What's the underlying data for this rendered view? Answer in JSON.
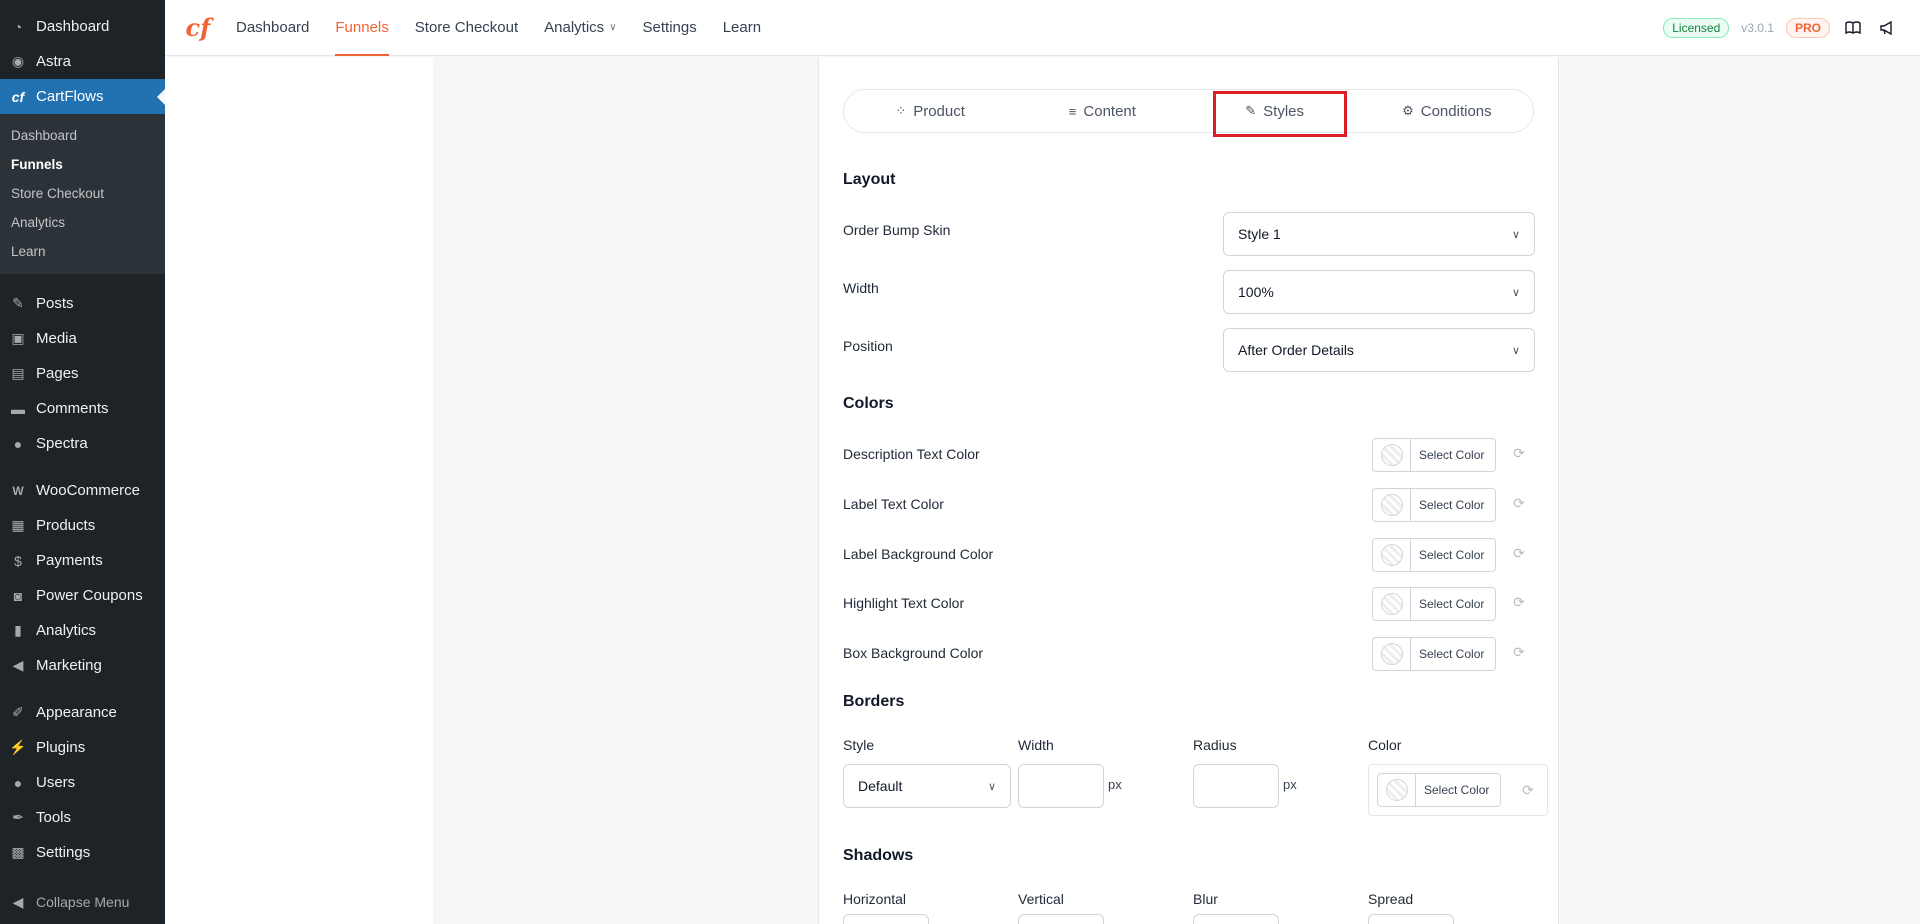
{
  "sidebar": {
    "items_top": [
      {
        "label": "Dashboard",
        "icon": "dashboard-icon"
      },
      {
        "label": "Astra",
        "icon": "astra-icon"
      },
      {
        "label": "CartFlows",
        "icon": "cartflows-icon"
      }
    ],
    "sub_items": [
      "Dashboard",
      "Funnels",
      "Store Checkout",
      "Analytics",
      "Learn"
    ],
    "items_group1": [
      {
        "label": "Posts",
        "icon": "pin-icon"
      },
      {
        "label": "Media",
        "icon": "media-icon"
      },
      {
        "label": "Pages",
        "icon": "pages-icon"
      },
      {
        "label": "Comments",
        "icon": "comment-icon"
      },
      {
        "label": "Spectra",
        "icon": "spectra-icon"
      }
    ],
    "items_group2": [
      {
        "label": "WooCommerce",
        "icon": "woo-icon"
      },
      {
        "label": "Products",
        "icon": "products-icon"
      },
      {
        "label": "Payments",
        "icon": "payments-icon"
      },
      {
        "label": "Power Coupons",
        "icon": "coupon-icon"
      },
      {
        "label": "Analytics",
        "icon": "bar-chart-icon"
      },
      {
        "label": "Marketing",
        "icon": "megaphone-icon"
      }
    ],
    "items_group3": [
      {
        "label": "Appearance",
        "icon": "brush-icon"
      },
      {
        "label": "Plugins",
        "icon": "plugin-icon"
      },
      {
        "label": "Users",
        "icon": "user-icon"
      },
      {
        "label": "Tools",
        "icon": "wrench-icon"
      },
      {
        "label": "Settings",
        "icon": "settings-icon"
      }
    ],
    "collapse_label": "Collapse Menu"
  },
  "topnav": {
    "items": [
      "Dashboard",
      "Funnels",
      "Store Checkout",
      "Analytics",
      "Settings",
      "Learn"
    ],
    "licensed": "Licensed",
    "version": "v3.0.1",
    "pro": "PRO"
  },
  "tabs": [
    "Product",
    "Content",
    "Styles",
    "Conditions"
  ],
  "layout": {
    "title": "Layout",
    "skin_label": "Order Bump Skin",
    "skin_value": "Style 1",
    "width_label": "Width",
    "width_value": "100%",
    "position_label": "Position",
    "position_value": "After Order Details"
  },
  "colors": {
    "title": "Colors",
    "select_text": "Select Color",
    "rows": [
      "Description Text Color",
      "Label Text Color",
      "Label Background Color",
      "Highlight Text Color",
      "Box Background Color"
    ]
  },
  "borders": {
    "title": "Borders",
    "style_label": "Style",
    "width_label": "Width",
    "radius_label": "Radius",
    "color_label": "Color",
    "style_value": "Default",
    "unit": "px",
    "select_text": "Select Color"
  },
  "shadows": {
    "title": "Shadows",
    "horizontal_label": "Horizontal",
    "vertical_label": "Vertical",
    "blur_label": "Blur",
    "spread_label": "Spread"
  }
}
